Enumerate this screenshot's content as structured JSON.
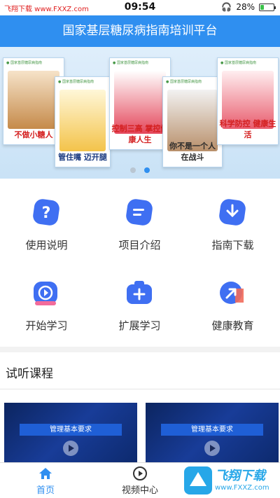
{
  "status": {
    "site": "飞翔下载 www.FXXZ.com",
    "time": "09:54",
    "battery": "28%",
    "battery_level": 0.28
  },
  "header": {
    "title": "国家基层糖尿病指南培训平台"
  },
  "banner": {
    "posters": [
      {
        "caption": "不做小糖人"
      },
      {
        "caption": "管住嘴 迈开腿"
      },
      {
        "caption": "控制三高 掌控健康人生"
      },
      {
        "caption": "你不是一个人 在战斗"
      },
      {
        "caption": "科学防控 健康生活"
      }
    ],
    "active_dot": 1
  },
  "menu": [
    {
      "label": "使用说明",
      "icon": "question-icon",
      "color": "#3f6ff2"
    },
    {
      "label": "项目介绍",
      "icon": "document-icon",
      "color": "#3f6ff2"
    },
    {
      "label": "指南下载",
      "icon": "download-icon",
      "color": "#3f6ff2"
    },
    {
      "label": "开始学习",
      "icon": "play-icon",
      "color": "#3f6ff2"
    },
    {
      "label": "扩展学习",
      "icon": "plus-icon",
      "color": "#3f6ff2"
    },
    {
      "label": "健康教育",
      "icon": "arrow-icon",
      "color": "#3f6ff2"
    }
  ],
  "section": {
    "title": "试听课程",
    "courses": [
      {
        "title": "管理基本要求"
      },
      {
        "title": "管理基本要求"
      }
    ]
  },
  "tabs": {
    "home": "首页",
    "video": "视频中心"
  },
  "watermark": {
    "text": "飞翔下载",
    "url": "www.FXXZ.com"
  },
  "colors": {
    "accent": "#2f8ff0",
    "icon_blue": "#3f6ff2",
    "icon_red": "#f26b5b"
  }
}
